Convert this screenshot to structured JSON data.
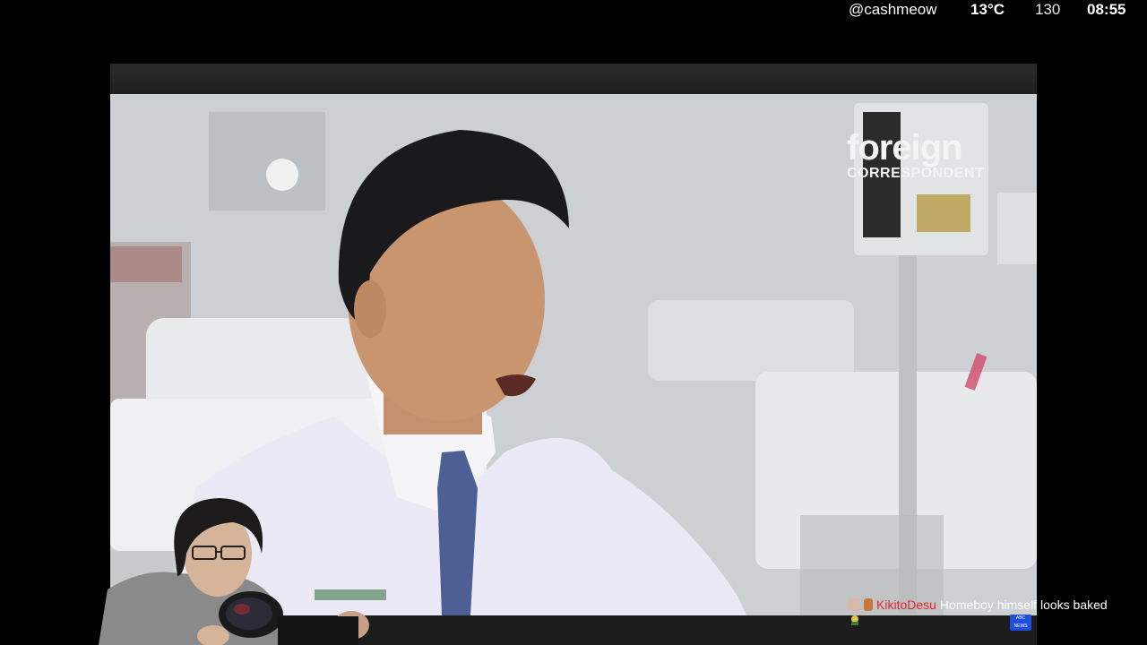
{
  "overlay": {
    "handle": "@cashmeow",
    "temperature": "13°C",
    "count": "130",
    "time": "08:55"
  },
  "video": {
    "watermark_title": "foreign",
    "watermark_subtitle": "CORRESPONDENT",
    "lower_logo": "ABC NEWS"
  },
  "chat": {
    "username": "KikitoDesu",
    "message": "Homeboy himself looks baked"
  },
  "colors": {
    "chat_username": "#e0282e",
    "badge_blue": "#1e4fd8"
  }
}
